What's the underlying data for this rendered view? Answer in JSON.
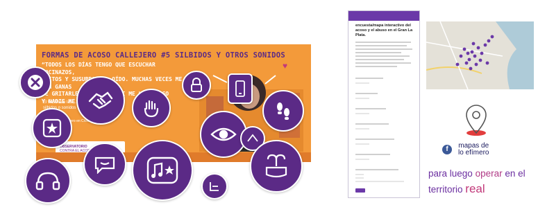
{
  "poster": {
    "title": "FORMAS DE ACOSO CALLEJERO #5 SILBIDOS Y OTROS SONIDOS",
    "quote_lines": [
      "“TODOS LOS DÍAS TENGO QUE ESCUCHAR BOCINAZOS,",
      "GRITOS Y SUSURROS AL OÍDO. MUCHAS VECES ME DAN GANAS",
      "DE GRITARLES QUE …PERO SI ME HACE ALGO",
      "Y NADIE ME AYU… MIEDO”."
    ],
    "stat_text": "El 94,7% de las … con",
    "stat_text_2": "silbidos o sonidos",
    "org_text": "…de Acoso Callejero en Chile",
    "observatory_label_1": "OBSERVATORIO",
    "observatory_label_2": "CONTRA EL ACOSO CALLEJERO",
    "fb_glyph": "f"
  },
  "icons": [
    {
      "name": "no-x-icon"
    },
    {
      "name": "handshake-icon"
    },
    {
      "name": "touch-hand-icon"
    },
    {
      "name": "lock-icon"
    },
    {
      "name": "phone-icon"
    },
    {
      "name": "footsteps-icon"
    },
    {
      "name": "flash-burst-icon"
    },
    {
      "name": "watching-eye-icon"
    },
    {
      "name": "speech-bubble-icon"
    },
    {
      "name": "music-note-star-icon"
    },
    {
      "name": "headphones-icon"
    },
    {
      "name": "camera-icon"
    },
    {
      "name": "hands-grab-icon"
    }
  ],
  "form": {
    "title": "encuesta/mapa interactivo del acoso y el abuso en el Gran La Plata."
  },
  "mapas_logo": {
    "fb_glyph": "f",
    "line1": "mapas de",
    "line2": "lo efímero"
  },
  "tagline": {
    "part1": "para luego",
    "part2": "operar",
    "part3": "en el",
    "part4": "territorio",
    "part5": "real"
  },
  "colors": {
    "bubble": "#5b2a86",
    "poster_bg": "#f39a3a",
    "accent_pink": "#c2397a",
    "tagline_purple": "#6b2fa0"
  }
}
